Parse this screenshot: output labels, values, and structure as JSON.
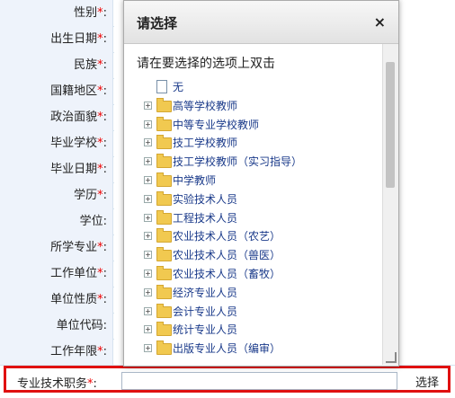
{
  "form": {
    "labels": [
      "性别",
      "出生日期",
      "民族",
      "国籍地区",
      "政治面貌",
      "毕业学校",
      "毕业日期",
      "学历",
      "学位",
      "所学专业",
      "工作单位",
      "单位性质",
      "单位代码",
      "工作年限"
    ],
    "required": [
      true,
      true,
      true,
      true,
      true,
      true,
      true,
      true,
      false,
      true,
      true,
      true,
      false,
      true
    ],
    "highlight_label": "专业技术职务",
    "select_button": "选择",
    "req_mark": "*",
    "colon": ":"
  },
  "dialog": {
    "title": "请选择",
    "close": "×",
    "hint": "请在要选择的选项上双击",
    "tree": [
      {
        "label": "无",
        "type": "doc"
      },
      {
        "label": "高等学校教师",
        "type": "folder"
      },
      {
        "label": "中等专业学校教师",
        "type": "folder"
      },
      {
        "label": "技工学校教师",
        "type": "folder"
      },
      {
        "label": "技工学校教师（实习指导）",
        "type": "folder"
      },
      {
        "label": "中学教师",
        "type": "folder"
      },
      {
        "label": "实验技术人员",
        "type": "folder"
      },
      {
        "label": "工程技术人员",
        "type": "folder"
      },
      {
        "label": "农业技术人员（农艺）",
        "type": "folder"
      },
      {
        "label": "农业技术人员（兽医）",
        "type": "folder"
      },
      {
        "label": "农业技术人员（畜牧）",
        "type": "folder"
      },
      {
        "label": "经济专业人员",
        "type": "folder"
      },
      {
        "label": "会计专业人员",
        "type": "folder"
      },
      {
        "label": "统计专业人员",
        "type": "folder"
      },
      {
        "label": "出版专业人员（编审）",
        "type": "folder"
      }
    ]
  }
}
